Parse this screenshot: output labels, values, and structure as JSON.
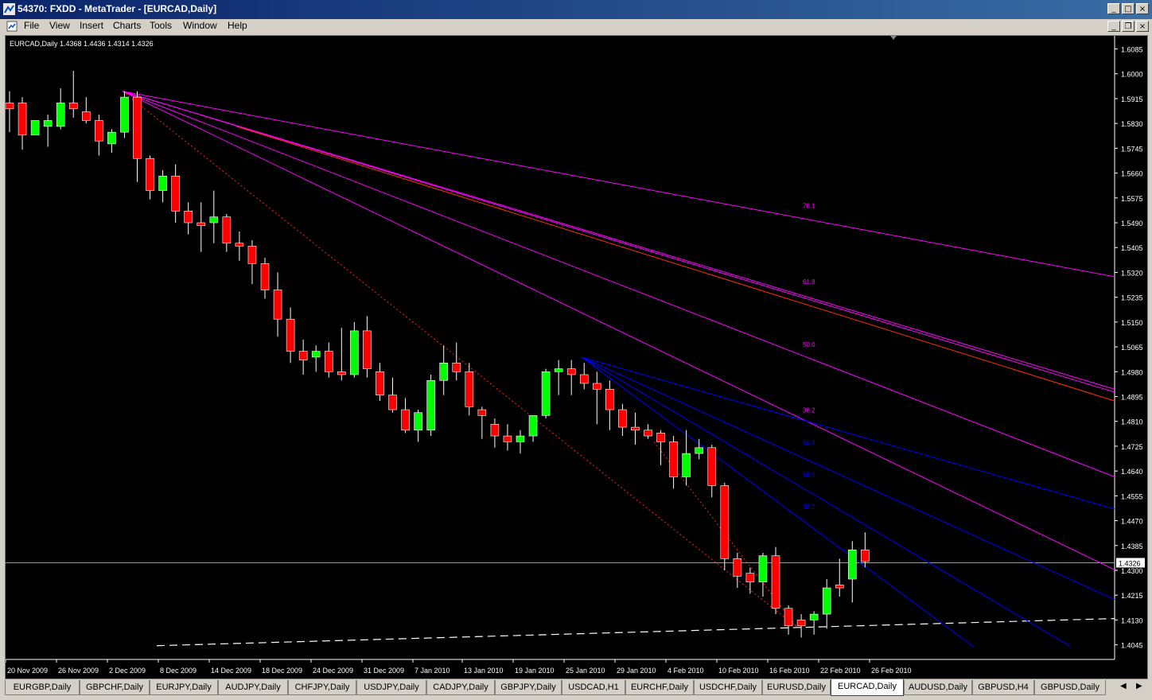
{
  "window": {
    "title": "54370: FXDD - MetaTrader - [EURCAD,Daily]",
    "buttons": [
      "_",
      "□",
      "×"
    ],
    "doc_buttons": [
      "_",
      "❐",
      "×"
    ]
  },
  "menu": [
    "File",
    "View",
    "Insert",
    "Charts",
    "Tools",
    "Window",
    "Help"
  ],
  "chart_header": "EURCAD,Daily  1.4368 1.4436 1.4314 1.4326",
  "current_price_label": "1.4326",
  "colors": {
    "background": "#000000",
    "bull": "#00ff00",
    "bear": "#ff0000",
    "fan_magenta": "#ff00ff",
    "fan_blue": "#0000ff",
    "trend_red": "#ff0000"
  },
  "tabs": [
    "EURGBP,Daily",
    "GBPCHF,Daily",
    "EURJPY,Daily",
    "AUDJPY,Daily",
    "CHFJPY,Daily",
    "USDJPY,Daily",
    "CADJPY,Daily",
    "GBPJPY,Daily",
    "USDCAD,H1",
    "EURCHF,Daily",
    "USDCHF,Daily",
    "EURUSD,Daily",
    "EURCAD,Daily",
    "AUDUSD,Daily",
    "GBPUSD,H4",
    "GBPUSD,Daily"
  ],
  "active_tab": "EURCAD,Daily",
  "chart_data": {
    "type": "candlestick",
    "symbol": "EURCAD",
    "timeframe": "Daily",
    "ylim": [
      1.3995,
      1.613
    ],
    "y_ticks": [
      "1.6085",
      "1.6000",
      "1.5915",
      "1.5830",
      "1.5745",
      "1.5660",
      "1.5575",
      "1.5490",
      "1.5405",
      "1.5320",
      "1.5235",
      "1.5150",
      "1.5065",
      "1.4980",
      "1.4895",
      "1.4810",
      "1.4725",
      "1.4640",
      "1.4555",
      "1.4470",
      "1.4385",
      "1.4300",
      "1.4215",
      "1.4130",
      "1.4045"
    ],
    "x_labels": [
      "20 Nov 2009",
      "26 Nov 2009",
      "2 Dec 2009",
      "8 Dec 2009",
      "14 Dec 2009",
      "18 Dec 2009",
      "24 Dec 2009",
      "31 Dec 2009",
      "7 Jan 2010",
      "13 Jan 2010",
      "19 Jan 2010",
      "25 Jan 2010",
      "29 Jan 2010",
      "4 Feb 2010",
      "10 Feb 2010",
      "16 Feb 2010",
      "22 Feb 2010",
      "26 Feb 2010"
    ],
    "candles": [
      [
        1.59,
        1.594,
        1.58,
        1.588
      ],
      [
        1.59,
        1.592,
        1.574,
        1.579
      ],
      [
        1.579,
        1.584,
        1.579,
        1.584
      ],
      [
        1.582,
        1.586,
        1.575,
        1.584
      ],
      [
        1.582,
        1.595,
        1.581,
        1.59
      ],
      [
        1.59,
        1.601,
        1.585,
        1.588
      ],
      [
        1.587,
        1.592,
        1.583,
        1.584
      ],
      [
        1.584,
        1.586,
        1.572,
        1.577
      ],
      [
        1.576,
        1.581,
        1.573,
        1.58
      ],
      [
        1.58,
        1.594,
        1.578,
        1.592
      ],
      [
        1.592,
        1.594,
        1.563,
        1.571
      ],
      [
        1.571,
        1.572,
        1.557,
        1.56
      ],
      [
        1.56,
        1.567,
        1.556,
        1.565
      ],
      [
        1.565,
        1.569,
        1.549,
        1.553
      ],
      [
        1.553,
        1.556,
        1.545,
        1.549
      ],
      [
        1.549,
        1.556,
        1.539,
        1.548
      ],
      [
        1.549,
        1.56,
        1.542,
        1.551
      ],
      [
        1.551,
        1.552,
        1.539,
        1.542
      ],
      [
        1.542,
        1.546,
        1.536,
        1.541
      ],
      [
        1.541,
        1.543,
        1.528,
        1.535
      ],
      [
        1.535,
        1.537,
        1.523,
        1.526
      ],
      [
        1.526,
        1.532,
        1.51,
        1.516
      ],
      [
        1.516,
        1.52,
        1.501,
        1.505
      ],
      [
        1.505,
        1.509,
        1.497,
        1.502
      ],
      [
        1.503,
        1.507,
        1.498,
        1.505
      ],
      [
        1.505,
        1.508,
        1.496,
        1.498
      ],
      [
        1.498,
        1.513,
        1.495,
        1.497
      ],
      [
        1.497,
        1.515,
        1.496,
        1.512
      ],
      [
        1.512,
        1.517,
        1.496,
        1.499
      ],
      [
        1.498,
        1.501,
        1.488,
        1.49
      ],
      [
        1.49,
        1.496,
        1.484,
        1.485
      ],
      [
        1.485,
        1.489,
        1.477,
        1.478
      ],
      [
        1.478,
        1.485,
        1.474,
        1.484
      ],
      [
        1.478,
        1.497,
        1.476,
        1.495
      ],
      [
        1.495,
        1.507,
        1.49,
        1.501
      ],
      [
        1.501,
        1.508,
        1.495,
        1.498
      ],
      [
        1.498,
        1.501,
        1.483,
        1.486
      ],
      [
        1.485,
        1.486,
        1.475,
        1.483
      ],
      [
        1.48,
        1.482,
        1.472,
        1.476
      ],
      [
        1.476,
        1.48,
        1.471,
        1.474
      ],
      [
        1.474,
        1.478,
        1.47,
        1.476
      ],
      [
        1.476,
        1.482,
        1.474,
        1.483
      ],
      [
        1.483,
        1.499,
        1.482,
        1.498
      ],
      [
        1.498,
        1.502,
        1.49,
        1.499
      ],
      [
        1.499,
        1.502,
        1.49,
        1.497
      ],
      [
        1.497,
        1.501,
        1.492,
        1.494
      ],
      [
        1.494,
        1.498,
        1.48,
        1.492
      ],
      [
        1.492,
        1.495,
        1.478,
        1.485
      ],
      [
        1.485,
        1.487,
        1.476,
        1.479
      ],
      [
        1.479,
        1.484,
        1.473,
        1.478
      ],
      [
        1.478,
        1.48,
        1.475,
        1.476
      ],
      [
        1.477,
        1.478,
        1.466,
        1.474
      ],
      [
        1.474,
        1.476,
        1.458,
        1.462
      ],
      [
        1.462,
        1.478,
        1.459,
        1.47
      ],
      [
        1.47,
        1.475,
        1.468,
        1.472
      ],
      [
        1.472,
        1.473,
        1.455,
        1.459
      ],
      [
        1.459,
        1.46,
        1.43,
        1.434
      ],
      [
        1.434,
        1.436,
        1.424,
        1.428
      ],
      [
        1.429,
        1.431,
        1.422,
        1.426
      ],
      [
        1.426,
        1.436,
        1.421,
        1.435
      ],
      [
        1.435,
        1.438,
        1.415,
        1.417
      ],
      [
        1.417,
        1.418,
        1.408,
        1.411
      ],
      [
        1.413,
        1.415,
        1.407,
        1.411
      ],
      [
        1.413,
        1.416,
        1.408,
        1.415
      ],
      [
        1.415,
        1.427,
        1.41,
        1.424
      ],
      [
        1.425,
        1.434,
        1.421,
        1.424
      ],
      [
        1.427,
        1.44,
        1.419,
        1.437
      ],
      [
        1.437,
        1.443,
        1.431,
        1.433
      ]
    ],
    "current_price": 1.4326,
    "fib_fan_1": {
      "color": "magenta",
      "levels": [
        "76.1",
        "61.8",
        "50.0",
        "38.2"
      ]
    },
    "fib_fan_2": {
      "color": "blue",
      "levels": [
        "61.8",
        "50.0",
        "38.2"
      ]
    }
  }
}
